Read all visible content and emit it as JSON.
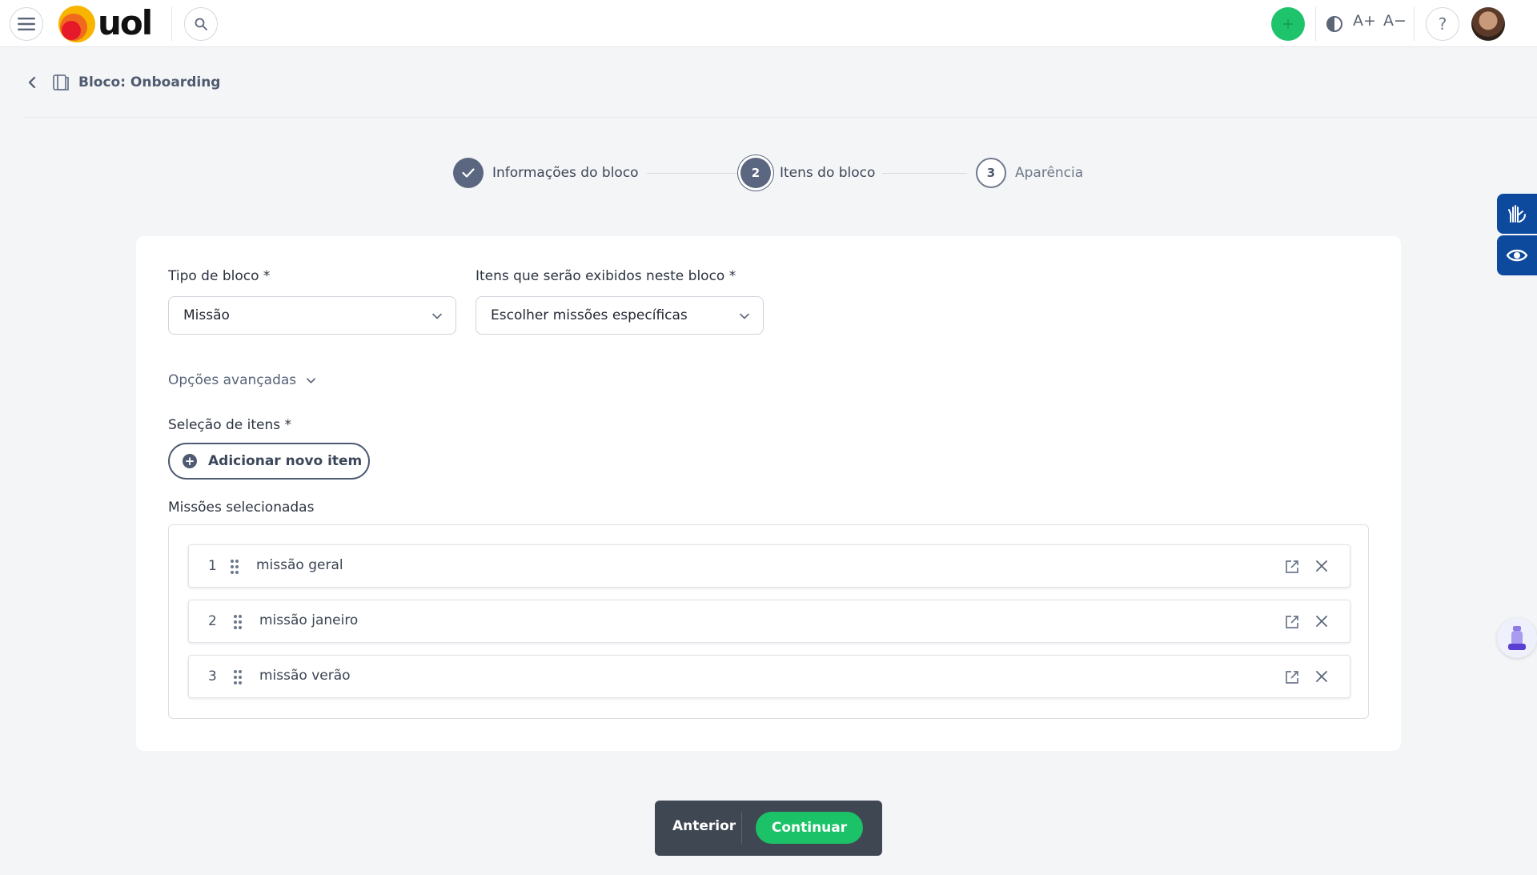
{
  "header": {
    "logo_text": "uol",
    "icons": [
      "menu-icon",
      "search-icon",
      "plus-icon",
      "contrast-icon",
      "help-icon"
    ],
    "font_increase_label": "A+",
    "font_decrease_label": "A−",
    "help_label": "?",
    "accent_color": "#1fc36b"
  },
  "breadcrumb": {
    "title": "Bloco: Onboarding"
  },
  "stepper": {
    "steps": [
      {
        "number": "✓",
        "label": "Informações do bloco",
        "state": "done"
      },
      {
        "number": "2",
        "label": "Itens do bloco",
        "state": "active"
      },
      {
        "number": "3",
        "label": "Aparência",
        "state": "pending"
      }
    ]
  },
  "form": {
    "block_type": {
      "label": "Tipo de bloco *",
      "value": "Missão"
    },
    "items_shown": {
      "label": "Itens que serão exibidos neste bloco *",
      "value": "Escolher missões específicas"
    },
    "advanced_options": "Opções avançadas",
    "item_selection_label": "Seleção de itens *",
    "add_item_button": "Adicionar novo item",
    "add_item_plus": "+",
    "selected_label": "Missões selecionadas",
    "selected_items": [
      {
        "number": "1",
        "label": "missão geral"
      },
      {
        "number": "2",
        "label": "missão janeiro"
      },
      {
        "number": "3",
        "label": "missão verão"
      }
    ]
  },
  "footer": {
    "previous_label": "Anterior",
    "continue_label": "Continuar",
    "continue_color": "#1cc267"
  },
  "side": {
    "icons": [
      "sign-language-icon",
      "eye-icon",
      "assistant-icon"
    ]
  }
}
